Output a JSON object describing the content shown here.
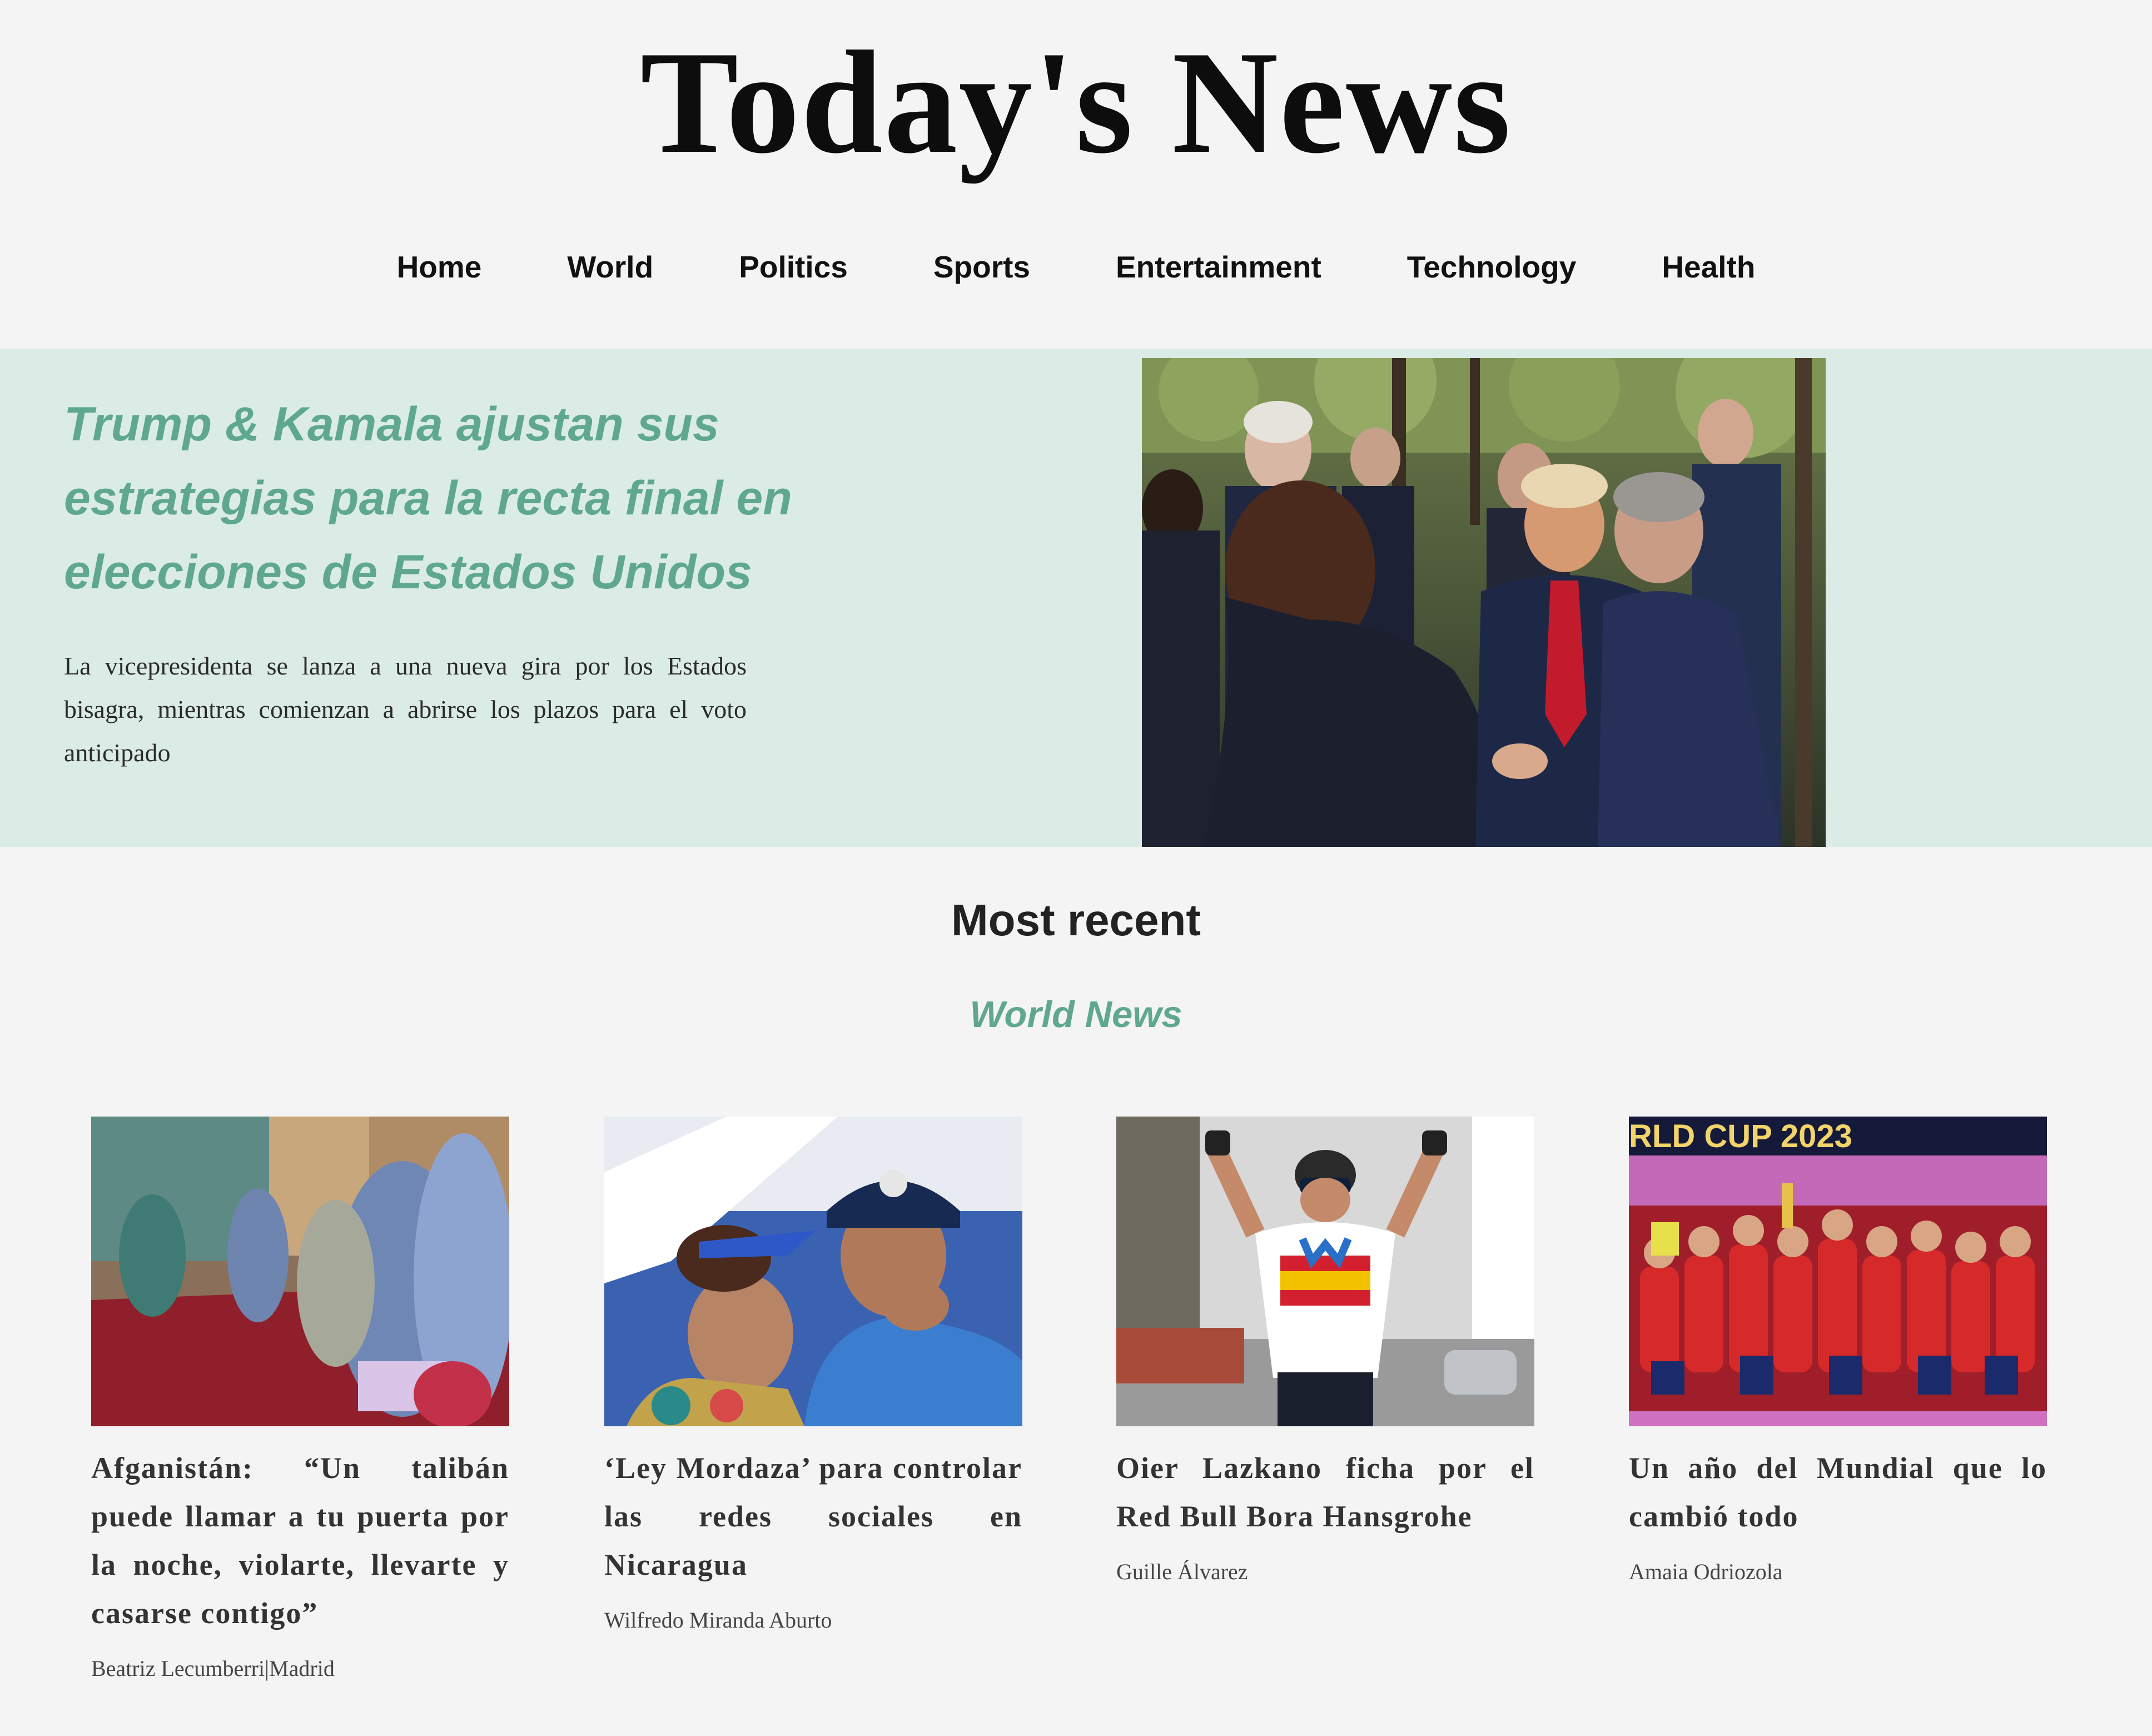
{
  "site": {
    "title": "Today's News"
  },
  "nav": {
    "items": [
      {
        "label": "Home"
      },
      {
        "label": "World"
      },
      {
        "label": "Politics"
      },
      {
        "label": "Sports"
      },
      {
        "label": "Entertainment"
      },
      {
        "label": "Technology"
      },
      {
        "label": "Health"
      }
    ]
  },
  "hero": {
    "title": "Trump & Kamala ajustan sus estrategias para la recta final en elecciones de Estados Unidos",
    "subtitle": "La vicepresidenta se lanza a una nueva gira por los Estados bisagra, mientras comienzan a abrirse los plazos para el voto anticipado",
    "background_color": "#dbece6",
    "accent_color": "#5fa88f"
  },
  "recent": {
    "title": "Most recent",
    "section": "World News",
    "articles": [
      {
        "headline": "Afganistán: “Un talibán puede llamar a tu puerta por la noche, violarte, llevarte y casarse contigo”",
        "author": "Beatriz Lecumberri|Madrid"
      },
      {
        "headline": "‘Ley Mordaza’ para controlar las redes sociales en Nicaragua",
        "author": "Wilfredo Miranda Aburto"
      },
      {
        "headline": "Oier Lazkano ficha por el Red Bull Bora Hansgrohe",
        "author": "Guille Álvarez"
      },
      {
        "headline": "Un año del Mundial que lo cambió todo",
        "author": "Amaia Odriozola"
      }
    ],
    "image_texts": {
      "world_cup_banner": "RLD CUP 2023"
    }
  }
}
